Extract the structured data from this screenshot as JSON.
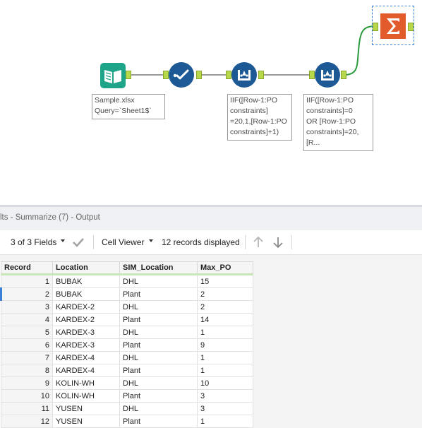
{
  "workflow": {
    "annotations": {
      "input": "Sample.xlsx\nQuery=`Sheet1$`",
      "formula1": "IIF([Row-1:PO\nconstraints]\n=20,1,[Row-1:PO\nconstraints]+1)",
      "formula2": "IIF([Row-1:PO\nconstraints]=0\nOR [Row-1:PO\nconstraints]=20,\n[R..."
    },
    "colors": {
      "input_tool": "#1ea589",
      "select_tool": "#1d5a95",
      "formula_tool": "#1d5a95",
      "summarize_tool": "#e25b2c",
      "anchor": "#b6d84a",
      "connection_highlight": "#2b9a3c"
    },
    "tools": [
      "input-data-icon",
      "select-icon",
      "multi-row-formula-icon",
      "multi-row-formula-icon",
      "summarize-icon"
    ]
  },
  "results": {
    "title": "lts - Summarize (7) - Output",
    "toolbar": {
      "fields_label": "3 of 3 Fields",
      "viewer_label": "Cell Viewer",
      "records_label": "12 records displayed"
    },
    "columns": [
      "Record",
      "Location",
      "SIM_Location",
      "Max_PO"
    ],
    "rows": [
      [
        "1",
        "BUBAK",
        "DHL",
        "15"
      ],
      [
        "2",
        "BUBAK",
        "Plant",
        "2"
      ],
      [
        "3",
        "KARDEX-2",
        "DHL",
        "2"
      ],
      [
        "4",
        "KARDEX-2",
        "Plant",
        "14"
      ],
      [
        "5",
        "KARDEX-3",
        "DHL",
        "1"
      ],
      [
        "6",
        "KARDEX-3",
        "Plant",
        "9"
      ],
      [
        "7",
        "KARDEX-4",
        "DHL",
        "1"
      ],
      [
        "8",
        "KARDEX-4",
        "Plant",
        "1"
      ],
      [
        "9",
        "KOLIN-WH",
        "DHL",
        "10"
      ],
      [
        "10",
        "KOLIN-WH",
        "Plant",
        "3"
      ],
      [
        "11",
        "YUSEN",
        "DHL",
        "3"
      ],
      [
        "12",
        "YUSEN",
        "Plant",
        "1"
      ]
    ]
  }
}
